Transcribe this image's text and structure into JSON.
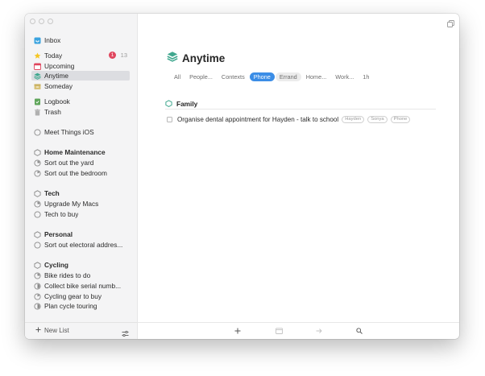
{
  "sidebar": {
    "items": [
      {
        "label": "Inbox",
        "icon": "inbox-icon",
        "color": "#3ba3df"
      },
      {
        "label": "Today",
        "icon": "star-icon",
        "color": "#f5c623",
        "badge": "1",
        "count": "13"
      },
      {
        "label": "Upcoming",
        "icon": "calendar-icon",
        "color": "#e0465e"
      },
      {
        "label": "Anytime",
        "icon": "stack-icon",
        "color": "#41a88f",
        "selected": true
      },
      {
        "label": "Someday",
        "icon": "box-icon",
        "color": "#d9c37a"
      },
      {
        "label": "Logbook",
        "icon": "logbook-icon",
        "color": "#5fa55a"
      },
      {
        "label": "Trash",
        "icon": "trash-icon",
        "color": "#a0a0a0"
      },
      {
        "label": "Meet Things iOS",
        "icon": "circle-icon"
      },
      {
        "label": "Home Maintenance",
        "icon": "area-icon",
        "bold": true
      },
      {
        "label": "Sort out the yard",
        "icon": "progress-icon"
      },
      {
        "label": "Sort out the bedroom",
        "icon": "progress-icon"
      },
      {
        "label": "Tech",
        "icon": "area-icon",
        "bold": true
      },
      {
        "label": "Upgrade My Macs",
        "icon": "progress-icon"
      },
      {
        "label": "Tech to buy",
        "icon": "circle-icon"
      },
      {
        "label": "Personal",
        "icon": "area-icon",
        "bold": true
      },
      {
        "label": "Sort out electoral addres...",
        "icon": "circle-icon"
      },
      {
        "label": "Cycling",
        "icon": "area-icon",
        "bold": true
      },
      {
        "label": "Bike rides to do",
        "icon": "progress-icon"
      },
      {
        "label": "Collect bike serial numb...",
        "icon": "progress-icon"
      },
      {
        "label": "Cycling gear to buy",
        "icon": "progress-icon"
      },
      {
        "label": "Plan cycle touring",
        "icon": "progress-icon"
      }
    ],
    "new_list_label": "New List"
  },
  "main": {
    "title": "Anytime",
    "title_icon_color": "#41a88f",
    "tags": [
      {
        "label": "All"
      },
      {
        "label": "People..."
      },
      {
        "label": "Contexts"
      },
      {
        "label": "Phone",
        "active": true
      },
      {
        "label": "Errand",
        "outlined": true
      },
      {
        "label": "Home..."
      },
      {
        "label": "Work..."
      },
      {
        "label": "1h"
      }
    ],
    "section": {
      "label": "Family",
      "icon": "area-icon",
      "color": "#41a88f"
    },
    "todo": {
      "title": "Organise dental appointment for Hayden - talk to school",
      "tags": [
        "Hayden",
        "Sonya",
        "Phone"
      ]
    }
  },
  "toolbar": {
    "icons": [
      "add-icon",
      "calendar-small-icon",
      "arrow-right-icon",
      "search-icon"
    ]
  },
  "colors": {
    "accent": "#3b8de6",
    "badge": "#e0465e"
  }
}
